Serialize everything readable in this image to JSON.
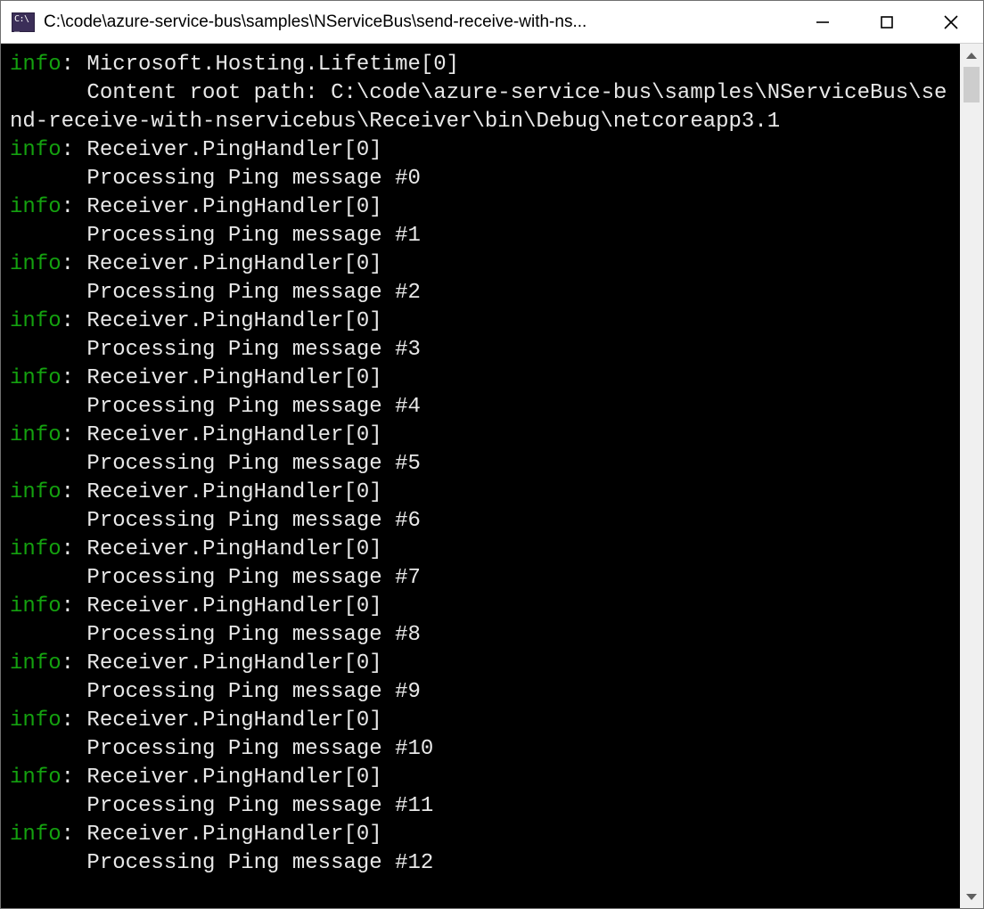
{
  "window": {
    "title": "C:\\code\\azure-service-bus\\samples\\NServiceBus\\send-receive-with-ns..."
  },
  "log": {
    "level_label": "info",
    "first_source": "Microsoft.Hosting.Lifetime[0]",
    "content_root_line": "      Content root path: C:\\code\\azure-service-bus\\samples\\NServiceBus\\send-receive-with-nservicebus\\Receiver\\bin\\Debug\\netcoreapp3.1",
    "entries": [
      {
        "source": "Receiver.PingHandler[0]",
        "msg": "Processing Ping message #0"
      },
      {
        "source": "Receiver.PingHandler[0]",
        "msg": "Processing Ping message #1"
      },
      {
        "source": "Receiver.PingHandler[0]",
        "msg": "Processing Ping message #2"
      },
      {
        "source": "Receiver.PingHandler[0]",
        "msg": "Processing Ping message #3"
      },
      {
        "source": "Receiver.PingHandler[0]",
        "msg": "Processing Ping message #4"
      },
      {
        "source": "Receiver.PingHandler[0]",
        "msg": "Processing Ping message #5"
      },
      {
        "source": "Receiver.PingHandler[0]",
        "msg": "Processing Ping message #6"
      },
      {
        "source": "Receiver.PingHandler[0]",
        "msg": "Processing Ping message #7"
      },
      {
        "source": "Receiver.PingHandler[0]",
        "msg": "Processing Ping message #8"
      },
      {
        "source": "Receiver.PingHandler[0]",
        "msg": "Processing Ping message #9"
      },
      {
        "source": "Receiver.PingHandler[0]",
        "msg": "Processing Ping message #10"
      },
      {
        "source": "Receiver.PingHandler[0]",
        "msg": "Processing Ping message #11"
      },
      {
        "source": "Receiver.PingHandler[0]",
        "msg": "Processing Ping message #12"
      }
    ]
  }
}
